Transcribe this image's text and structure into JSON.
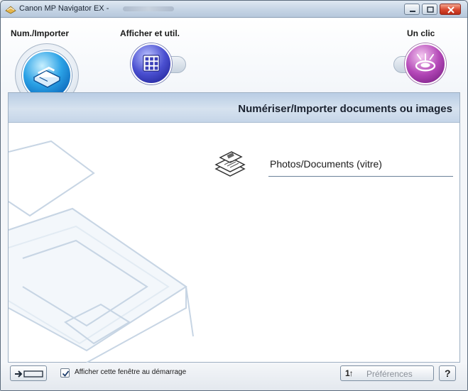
{
  "window": {
    "title": "Canon MP Navigator EX - "
  },
  "nav": {
    "scan_label": "Num./Importer",
    "view_label": "Afficher et util.",
    "oneclick_label": "Un clic",
    "selected": "scan"
  },
  "panel": {
    "title": "Numériser/Importer documents ou images",
    "items": [
      {
        "label": "Photos/Documents (vitre)",
        "icon": "photos-documents-icon"
      }
    ]
  },
  "footer": {
    "show_on_start_label": "Afficher cette fenêtre au démarrage",
    "show_on_start_checked": true,
    "preferences_icon_text": "1↑",
    "preferences_label": "Préférences",
    "help_label": "?"
  },
  "colors": {
    "scan_accent": "#1a8ee0",
    "view_accent": "#3e44c6",
    "oneclick_accent": "#a43fb0",
    "panel_header": "#c5d5e8"
  }
}
